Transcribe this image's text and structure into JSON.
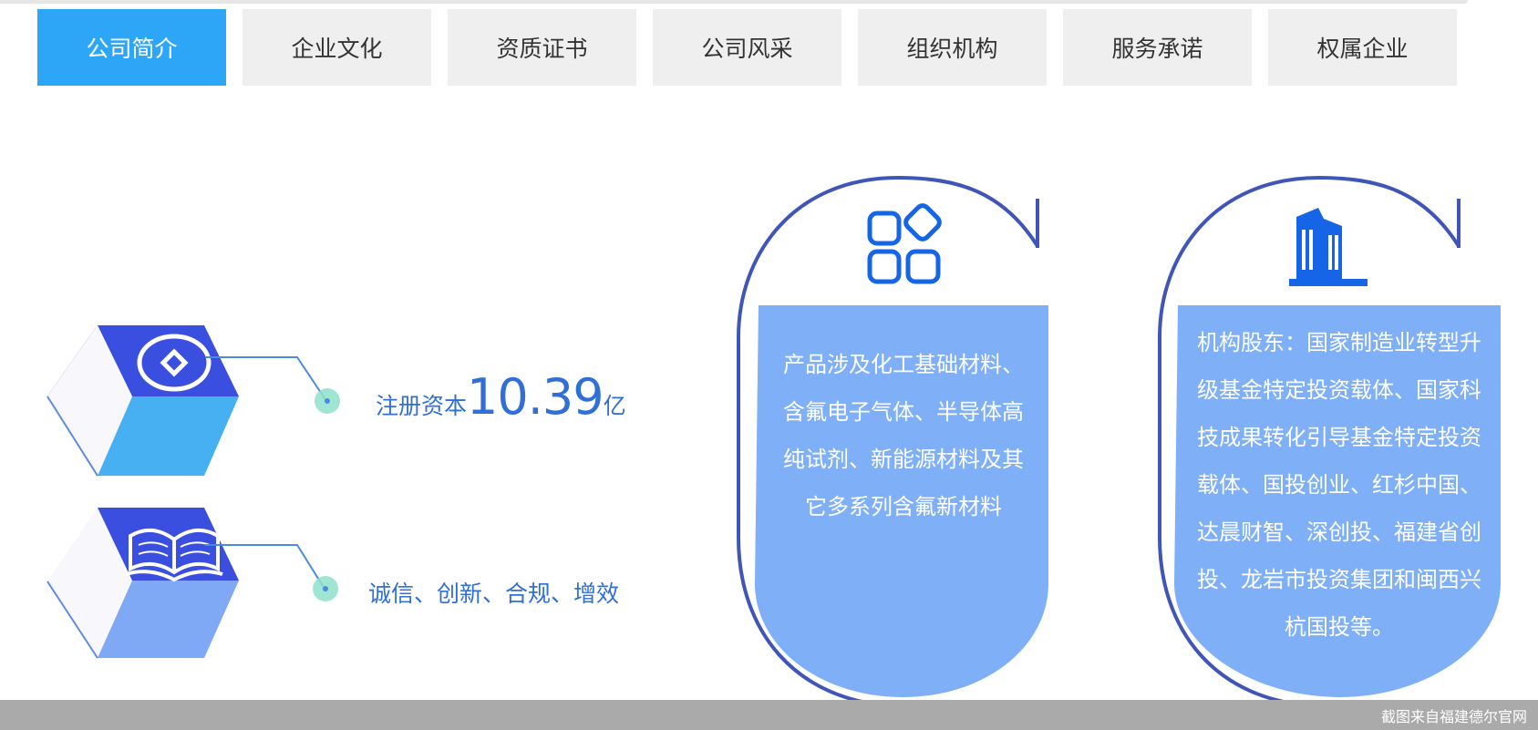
{
  "tabs": [
    {
      "label": "公司简介",
      "active": true
    },
    {
      "label": "企业文化",
      "active": false
    },
    {
      "label": "资质证书",
      "active": false
    },
    {
      "label": "公司风采",
      "active": false
    },
    {
      "label": "组织机构",
      "active": false
    },
    {
      "label": "服务承诺",
      "active": false
    },
    {
      "label": "权属企业",
      "active": false
    }
  ],
  "stats": {
    "capital": {
      "prefix": "注册资本",
      "value": "10.39",
      "unit": "亿"
    },
    "values": "诚信、创新、合规、增效"
  },
  "panels": {
    "products": {
      "icon": "apps-grid-icon",
      "lines": [
        "产品涉及化工基础材料、",
        "含氟电子气体、半导体高",
        "纯试剂、新能源材料及其",
        "它多系列含氟新材料"
      ]
    },
    "shareholders": {
      "icon": "building-icon",
      "lines": [
        "机构股东：国家制造业转型升",
        "级基金特定投资载体、国家科",
        "技成果转化引导基金特定投资",
        "载体、国投创业、红杉中国、",
        "达晨财智、深创投、福建省创",
        "投、龙岩市投资集团和闽西兴",
        "杭国投等。"
      ]
    }
  },
  "footer": {
    "note": "截图来自福建德尔官网"
  },
  "colors": {
    "active_tab": "#2ea6f7",
    "tab_bg": "#efefef",
    "panel_fill": "#7fb0f7",
    "arc": "#3f56b8",
    "icon_blue": "#1565e6",
    "stat_text": "#2f6fd6",
    "dot": "#8fe0cc"
  }
}
